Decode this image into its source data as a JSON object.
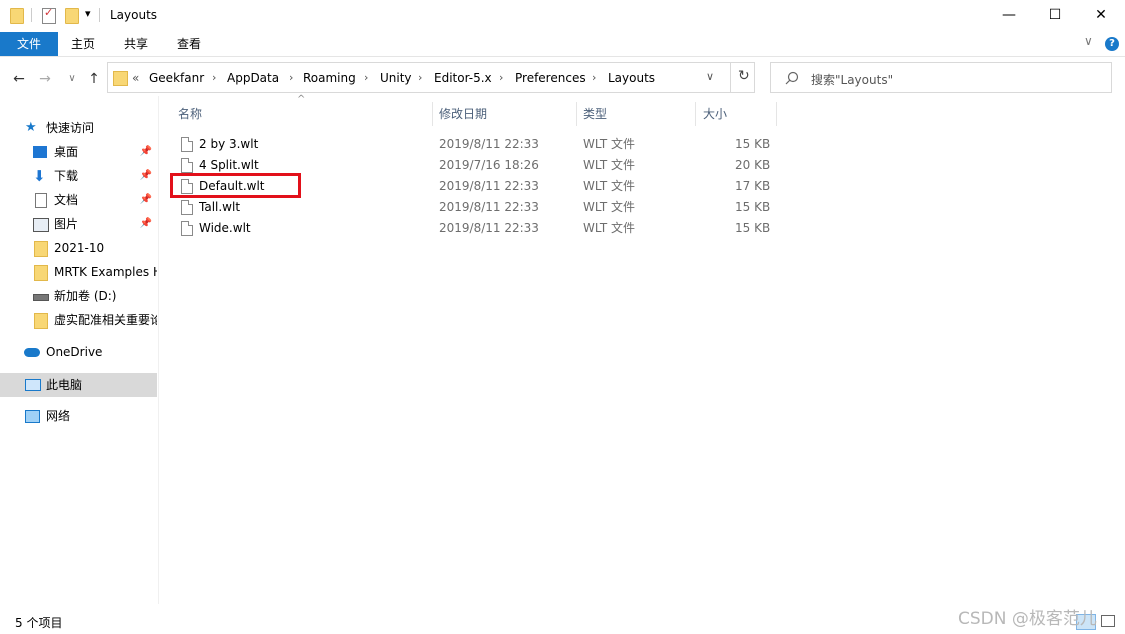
{
  "window": {
    "title": "Layouts",
    "minimize_glyph": "—",
    "maximize_glyph": "☐",
    "close_glyph": "✕",
    "help_icon": "help-icon",
    "collapse_icon": "chevron-down-icon"
  },
  "quick_access_toolbar": {
    "icons": [
      "folder-icon",
      "properties-icon",
      "new-folder-icon"
    ],
    "dropdown_glyph": "▾"
  },
  "ribbon": {
    "tabs": [
      {
        "label": "文件",
        "active": true
      },
      {
        "label": "主页"
      },
      {
        "label": "共享"
      },
      {
        "label": "查看"
      }
    ],
    "help_glyph": "?",
    "expand_glyph": "∨"
  },
  "navigation": {
    "back_glyph": "←",
    "forward_glyph": "→",
    "recent_glyph": "∨",
    "up_glyph": "↑"
  },
  "address_bar": {
    "overflow": "«",
    "separator": "›",
    "crumbs": [
      "Geekfanr",
      "AppData",
      "Roaming",
      "Unity",
      "Editor-5.x",
      "Preferences",
      "Layouts"
    ],
    "dropdown_glyph": "∨",
    "refresh_glyph": "↻"
  },
  "search": {
    "placeholder": "搜索\"Layouts\"",
    "icon": "search-icon"
  },
  "sidebar": {
    "quick_access": {
      "label": "快速访问",
      "icon": "star-icon"
    },
    "items": [
      {
        "label": "桌面",
        "icon": "desktop-icon",
        "pinned": true
      },
      {
        "label": "下载",
        "icon": "download-icon",
        "pinned": true
      },
      {
        "label": "文档",
        "icon": "document-icon",
        "pinned": true
      },
      {
        "label": "图片",
        "icon": "picture-icon",
        "pinned": true
      },
      {
        "label": "2021-10",
        "icon": "folder-icon"
      },
      {
        "label": "MRTK Examples H",
        "icon": "folder-icon"
      },
      {
        "label": "新加卷 (D:)",
        "icon": "drive-icon"
      },
      {
        "label": "虚实配准相关重要论",
        "icon": "folder-icon"
      }
    ],
    "pin_glyph": "📌",
    "onedrive": {
      "label": "OneDrive",
      "icon": "cloud-icon"
    },
    "this_pc": {
      "label": "此电脑",
      "icon": "computer-icon",
      "selected": true
    },
    "network": {
      "label": "网络",
      "icon": "network-icon"
    }
  },
  "file_list": {
    "sort_glyph": "^",
    "columns": [
      "名称",
      "修改日期",
      "类型",
      "大小"
    ],
    "rows": [
      {
        "name": "2 by 3.wlt",
        "modified": "2019/8/11 22:33",
        "type": "WLT 文件",
        "size": "15 KB"
      },
      {
        "name": "4 Split.wlt",
        "modified": "2019/7/16 18:26",
        "type": "WLT 文件",
        "size": "20 KB"
      },
      {
        "name": "Default.wlt",
        "modified": "2019/8/11 22:33",
        "type": "WLT 文件",
        "size": "17 KB",
        "highlighted": true
      },
      {
        "name": "Tall.wlt",
        "modified": "2019/8/11 22:33",
        "type": "WLT 文件",
        "size": "15 KB"
      },
      {
        "name": "Wide.wlt",
        "modified": "2019/8/11 22:33",
        "type": "WLT 文件",
        "size": "15 KB"
      }
    ]
  },
  "status_bar": {
    "item_count": "5 个项目",
    "details_view_icon": "details-view-icon",
    "large_icons_view_icon": "large-icons-view-icon"
  },
  "watermark": "CSDN @极客范儿",
  "colors": {
    "file_tab": "#1979ca",
    "selection": "#d9d9d9",
    "highlight_box": "#e2101a",
    "folder": "#f8d775",
    "header_text": "#4c607a"
  }
}
